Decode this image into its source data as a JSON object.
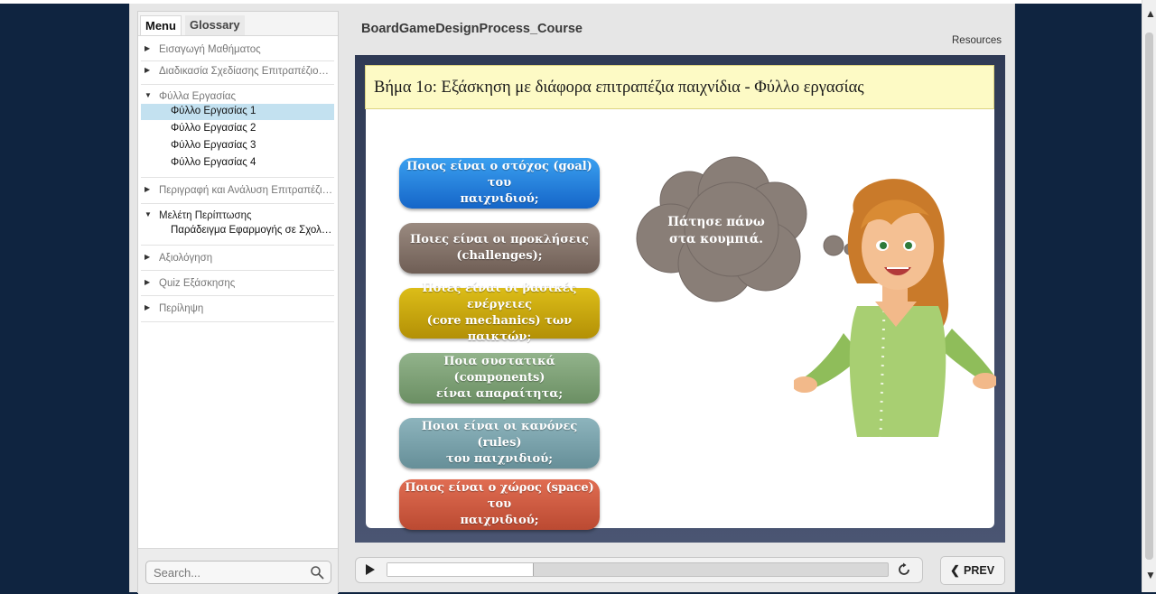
{
  "course": {
    "title": "BoardGameDesignProcess_Course",
    "resources_label": "Resources"
  },
  "sidebar": {
    "tabs": {
      "menu": "Menu",
      "glossary": "Glossary"
    },
    "items": [
      {
        "label": "Εισαγωγή Μαθήματος"
      },
      {
        "label": "Διαδικασία Σχεδίασης Επιτραπέζιου Παιχνιδιού"
      },
      {
        "label": "Φύλλα Εργασίας"
      },
      {
        "label": "Περιγραφή και Ανάλυση Επιτραπέζιου Παιχνιδιού"
      },
      {
        "label": "Μελέτη Περίπτωσης"
      },
      {
        "label": "Αξιολόγηση"
      },
      {
        "label": "Quiz Εξάσκησης"
      },
      {
        "label": "Περίληψη"
      }
    ],
    "worksheets": [
      {
        "label": "Φύλλο Εργασίας 1"
      },
      {
        "label": "Φύλλο Εργασίας 2"
      },
      {
        "label": "Φύλλο Εργασίας 3"
      },
      {
        "label": "Φύλλο Εργασίας 4"
      }
    ],
    "case_study": [
      {
        "label": "Παράδειγμα Εφαρμογής σε Σχολική Τάξη"
      }
    ],
    "search_placeholder": "Search..."
  },
  "slide": {
    "title": "Βήμα 1ο: Εξάσκηση με διάφορα επιτραπέζια παιχνίδια - Φύλλο εργασίας",
    "buttons": [
      {
        "line1": "Ποιος είναι ο στόχος (goal) του",
        "line2": "παιχνιδιού;",
        "color": "#1e88e5"
      },
      {
        "line1": "Ποιες είναι οι προκλήσεις",
        "line2": "(challenges);",
        "color": "#86746a"
      },
      {
        "line1": "Ποιες είναι οι βασικές ενέργειες",
        "line2": "(core mechanics) των παικτών;",
        "color": "#c9a70a"
      },
      {
        "line1": "Ποια συστατικά (components)",
        "line2": "είναι απαραίτητα;",
        "color": "#7fa177"
      },
      {
        "line1": "Ποιοι είναι οι κανόνες (rules)",
        "line2": "του παιχνιδιού;",
        "color": "#7aa2ab"
      },
      {
        "line1": "Ποιος είναι ο χώρος (space) του",
        "line2": "παιχνιδιού;",
        "color": "#cf5a40"
      }
    ],
    "bubble_text": "Πάτησε πάνω στα κουμπιά."
  },
  "playbar": {
    "progress": 0.29,
    "prev_label": "PREV"
  }
}
